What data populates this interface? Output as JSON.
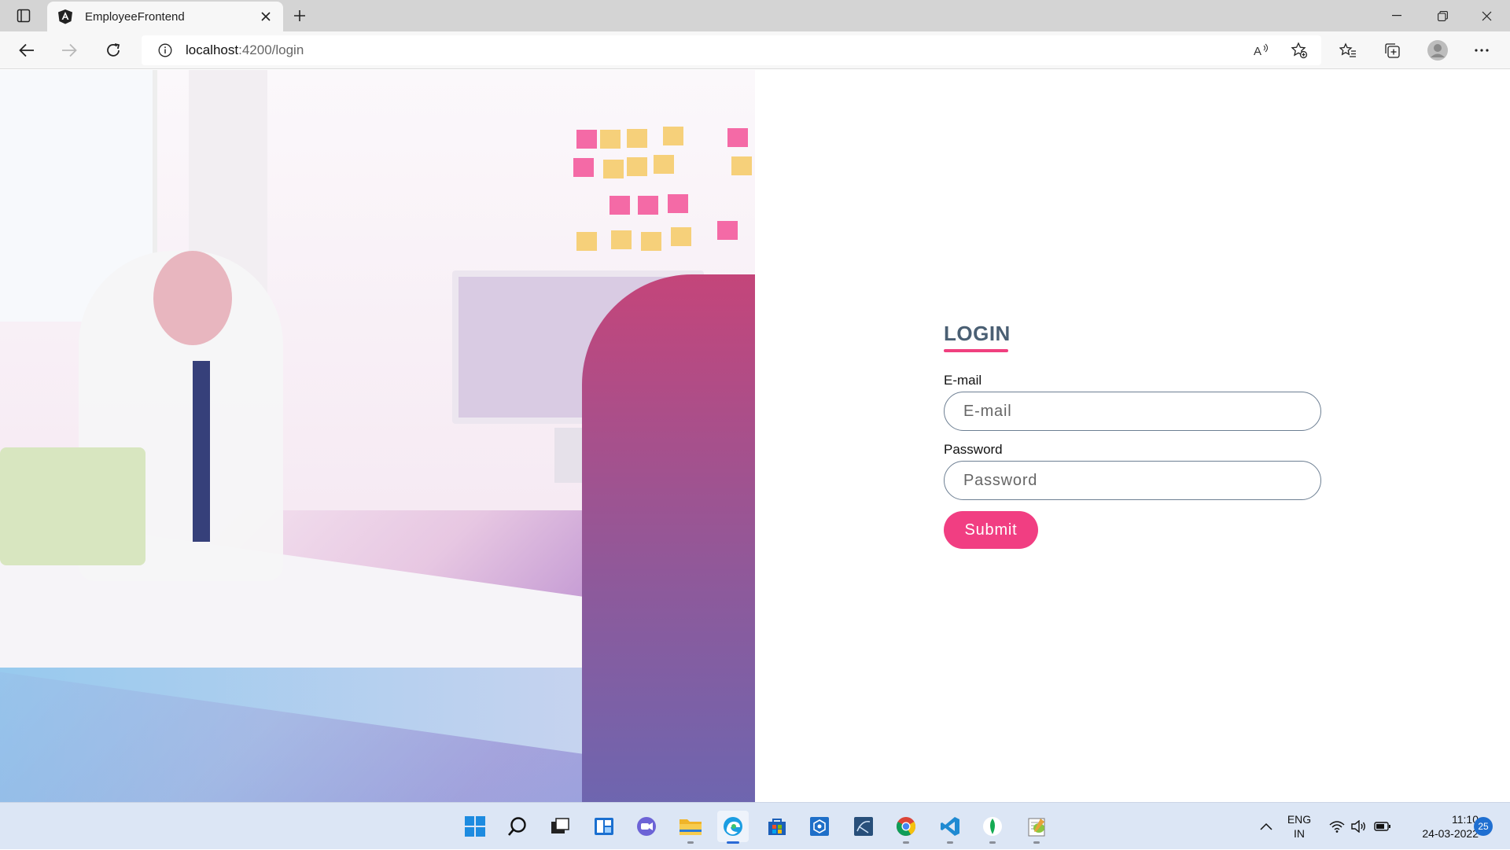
{
  "browser": {
    "tab_title": "EmployeeFrontend",
    "url_host": "localhost",
    "url_path": ":4200/login"
  },
  "login": {
    "title": "LOGIN",
    "email_label": "E-mail",
    "email_placeholder": "E-mail",
    "password_label": "Password",
    "password_placeholder": "Password",
    "submit_label": "Submit"
  },
  "colors": {
    "accent": "#f13e82",
    "title": "#4a5f73"
  },
  "taskbar": {
    "language_line1": "ENG",
    "language_line2": "IN",
    "time": "11:10",
    "date": "24-03-2022",
    "notifications": "25",
    "apps": [
      "start-icon",
      "search-icon",
      "task-view-icon",
      "widgets-icon",
      "chat-icon",
      "file-explorer-icon",
      "edge-icon",
      "store-icon",
      "azure-data-studio-icon",
      "sql-server-icon",
      "chrome-icon",
      "vscode-icon",
      "mongodb-icon",
      "notepad-plus-plus-icon"
    ]
  }
}
